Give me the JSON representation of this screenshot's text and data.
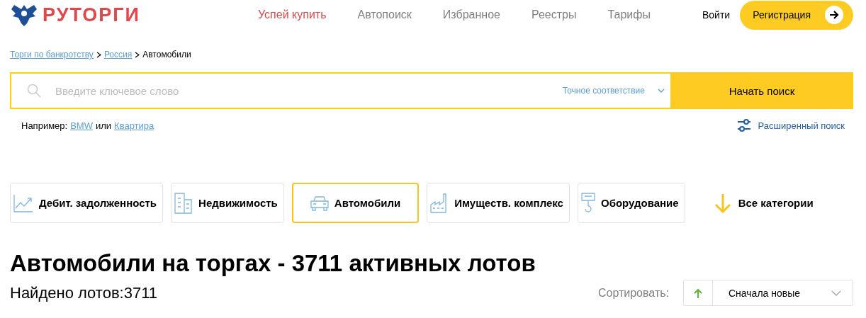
{
  "logo": {
    "text": "РУТОРГИ"
  },
  "nav": [
    {
      "label": "Успей купить",
      "selected": true
    },
    {
      "label": "Автопоиск",
      "selected": false
    },
    {
      "label": "Избранное",
      "selected": false
    },
    {
      "label": "Реестры",
      "selected": false
    },
    {
      "label": "Тарифы",
      "selected": false
    }
  ],
  "login": "Войти",
  "register": "Регистрация",
  "breadcrumbs": [
    {
      "label": "Торги по банкротству",
      "link": true
    },
    {
      "label": "Россия",
      "link": true
    },
    {
      "label": "Автомобили",
      "link": false
    }
  ],
  "search": {
    "placeholder": "Введите ключевое слово",
    "match": "Точное соответствие",
    "button": "Начать поиск"
  },
  "examples": {
    "prefix": "Например:",
    "first": "BMW",
    "joiner": "или",
    "second": "Квартира"
  },
  "advanced": "Расширенный поиск",
  "categories": [
    {
      "label": "Дебит. задолженность",
      "kind": "chart",
      "selected": false
    },
    {
      "label": "Недвижимость",
      "kind": "building",
      "selected": false
    },
    {
      "label": "Автомобили",
      "kind": "car",
      "selected": true
    },
    {
      "label": "Имуществ. комплекс",
      "kind": "factory",
      "selected": false
    },
    {
      "label": "Оборудование",
      "kind": "equipment",
      "selected": false
    }
  ],
  "all_categories": "Все категории",
  "heading": "Автомобили на торгах - 3711 активных лотов",
  "found": "Найдено лотов:3711",
  "sort": {
    "label": "Сортировать:",
    "value": "Сначала новые"
  }
}
